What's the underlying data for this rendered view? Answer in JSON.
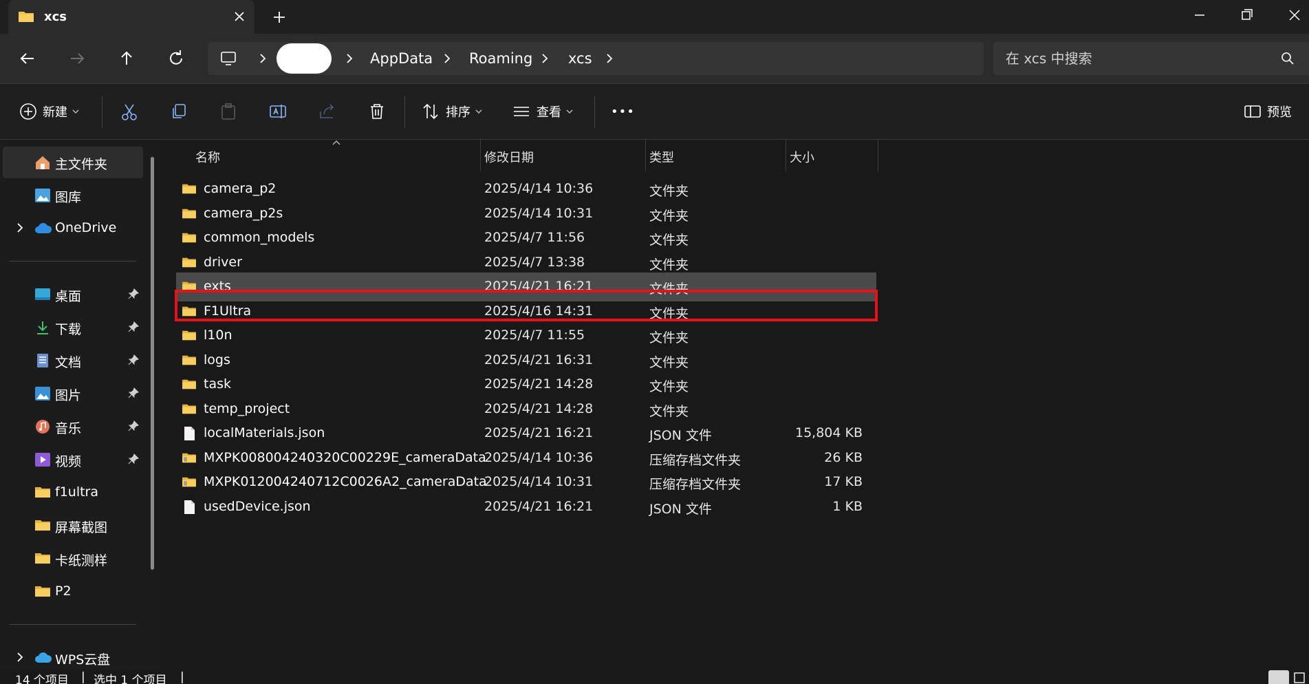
{
  "window": {
    "tab_title": "xcs",
    "tab_icon": "folder-icon",
    "accent_folder_color": "#f2c14e",
    "selection_highlight_color": "#e8101a"
  },
  "address": {
    "segments": [
      "AppData",
      "Roaming",
      "xcs"
    ],
    "search_placeholder": "在 xcs 中搜索"
  },
  "toolbar": {
    "new_label": "新建",
    "sort_label": "排序",
    "view_label": "查看",
    "more_label": "•••",
    "preview_label": "预览"
  },
  "sidebar": {
    "home": "主文件夹",
    "gallery": "图库",
    "onedrive": "OneDrive",
    "pinned": [
      {
        "label": "桌面",
        "icon": "desktop-icon"
      },
      {
        "label": "下载",
        "icon": "download-icon"
      },
      {
        "label": "文档",
        "icon": "document-icon"
      },
      {
        "label": "图片",
        "icon": "pictures-icon"
      },
      {
        "label": "音乐",
        "icon": "music-icon"
      },
      {
        "label": "视频",
        "icon": "video-icon"
      }
    ],
    "folders": [
      "f1ultra",
      "屏幕截图",
      "卡纸测样",
      "P2"
    ],
    "wps": "WPS云盘"
  },
  "columns": {
    "name": "名称",
    "date": "修改日期",
    "type": "类型",
    "size": "大小"
  },
  "files": [
    {
      "name": "camera_p2",
      "date": "2025/4/14 10:36",
      "type": "文件夹",
      "size": "",
      "kind": "folder"
    },
    {
      "name": "camera_p2s",
      "date": "2025/4/14 10:31",
      "type": "文件夹",
      "size": "",
      "kind": "folder"
    },
    {
      "name": "common_models",
      "date": "2025/4/7 11:56",
      "type": "文件夹",
      "size": "",
      "kind": "folder"
    },
    {
      "name": "driver",
      "date": "2025/4/7 13:38",
      "type": "文件夹",
      "size": "",
      "kind": "folder"
    },
    {
      "name": "exts",
      "date": "2025/4/21 16:21",
      "type": "文件夹",
      "size": "",
      "kind": "folder",
      "selected": true
    },
    {
      "name": "F1Ultra",
      "date": "2025/4/16 14:31",
      "type": "文件夹",
      "size": "",
      "kind": "folder"
    },
    {
      "name": "l10n",
      "date": "2025/4/7 11:55",
      "type": "文件夹",
      "size": "",
      "kind": "folder"
    },
    {
      "name": "logs",
      "date": "2025/4/21 16:31",
      "type": "文件夹",
      "size": "",
      "kind": "folder"
    },
    {
      "name": "task",
      "date": "2025/4/21 14:28",
      "type": "文件夹",
      "size": "",
      "kind": "folder"
    },
    {
      "name": "temp_project",
      "date": "2025/4/21 14:28",
      "type": "文件夹",
      "size": "",
      "kind": "folder"
    },
    {
      "name": "localMaterials.json",
      "date": "2025/4/21 16:21",
      "type": "JSON 文件",
      "size": "15,804 KB",
      "kind": "file"
    },
    {
      "name": "MXPK008004240320C00229E_cameraData",
      "date": "2025/4/14 10:36",
      "type": "压缩存档文件夹",
      "size": "26 KB",
      "kind": "zip"
    },
    {
      "name": "MXPK012004240712C0026A2_cameraData",
      "date": "2025/4/14 10:31",
      "type": "压缩存档文件夹",
      "size": "17 KB",
      "kind": "zip"
    },
    {
      "name": "usedDevice.json",
      "date": "2025/4/21 16:21",
      "type": "JSON 文件",
      "size": "1 KB",
      "kind": "file"
    }
  ],
  "status": {
    "count": "14 个项目",
    "selected": "选中 1 个项目"
  }
}
